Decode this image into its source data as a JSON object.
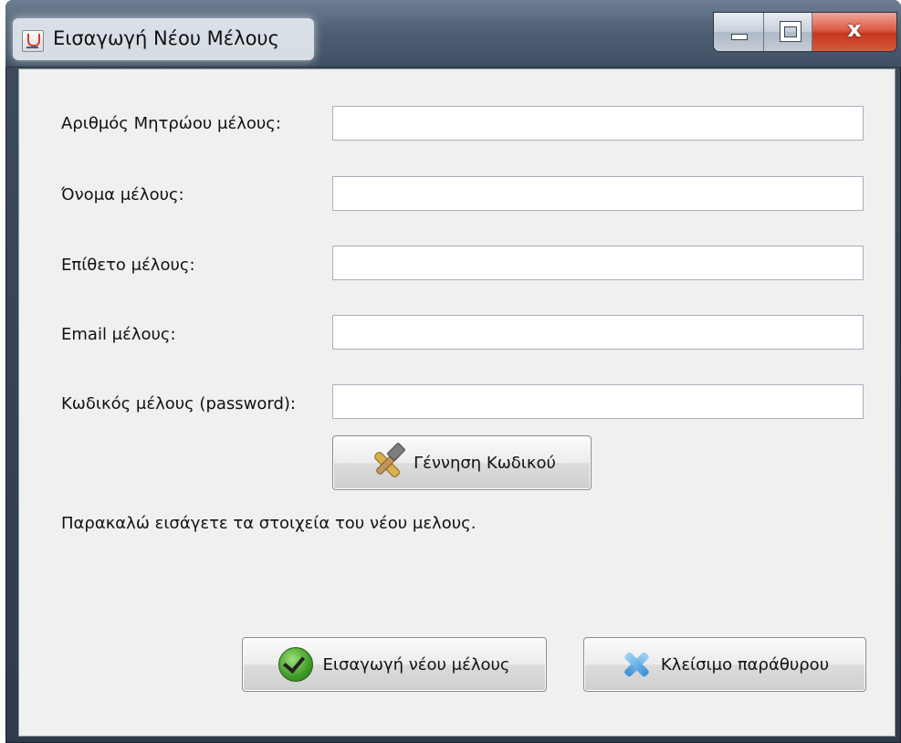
{
  "window": {
    "title": "Εισαγωγή Νέου Μέλους",
    "controls": {
      "minimize": "minimize",
      "maximize": "maximize",
      "close": "x"
    }
  },
  "form": {
    "fields": [
      {
        "label": "Αριθμός Μητρώου μέλους:",
        "value": ""
      },
      {
        "label": "Όνομα μέλους:",
        "value": ""
      },
      {
        "label": "Επίθετο μέλους:",
        "value": ""
      },
      {
        "label": "Email μέλους:",
        "value": ""
      },
      {
        "label": "Κωδικός μέλους (password):",
        "value": ""
      }
    ],
    "generate_button": {
      "label": "Γέννηση Κωδικού",
      "icon": "tools-icon"
    },
    "status_message": "Παρακαλώ εισάγετε τα στοιχεία του νέου μελους."
  },
  "actions": {
    "insert_button": {
      "label": "Εισαγωγή νέου μέλους",
      "icon": "checkmark-icon"
    },
    "close_button": {
      "label": "Κλείσιμο παράθυρου",
      "icon": "close-x-icon"
    }
  },
  "colors": {
    "title_bar": "#4f6075",
    "panel_bg": "#f0f0f0",
    "close_button": "#c5371f",
    "check_green": "#3f9b26",
    "x_blue": "#3b8fd4"
  }
}
